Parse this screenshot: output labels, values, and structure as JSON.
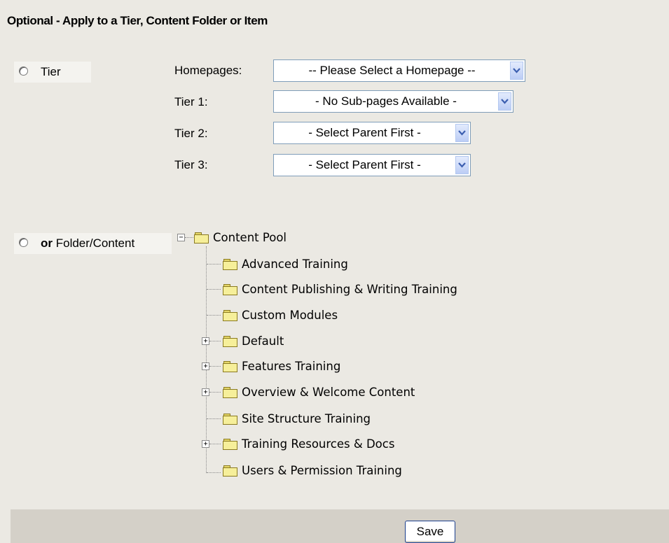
{
  "heading": "Optional - Apply to a Tier, Content Folder or Item",
  "tier_option": {
    "label": "Tier",
    "fields": [
      {
        "label": "Homepages:",
        "value": "-- Please Select a Homepage --"
      },
      {
        "label": "Tier 1:",
        "value": "- No Sub-pages Available -"
      },
      {
        "label": "Tier 2:",
        "value": "- Select Parent First -"
      },
      {
        "label": "Tier 3:",
        "value": "- Select Parent First -"
      }
    ]
  },
  "folder_option": {
    "label_bold": "or",
    "label": "Folder/Content",
    "root": {
      "label": "Content Pool",
      "expanded": true
    },
    "children": [
      {
        "label": "Advanced Training",
        "expandable": false
      },
      {
        "label": "Content Publishing & Writing Training",
        "expandable": false
      },
      {
        "label": "Custom Modules",
        "expandable": false
      },
      {
        "label": "Default",
        "expandable": true
      },
      {
        "label": "Features Training",
        "expandable": true
      },
      {
        "label": "Overview & Welcome Content",
        "expandable": true
      },
      {
        "label": "Site Structure Training",
        "expandable": false
      },
      {
        "label": "Training Resources & Docs",
        "expandable": true
      },
      {
        "label": "Users & Permission Training",
        "expandable": false
      }
    ]
  },
  "save_button": "Save",
  "icons": {
    "dropdown": "chevron-down-icon",
    "folder": "folder-icon",
    "expand": "plus-expander-icon",
    "collapse": "minus-collapser-icon"
  },
  "colors": {
    "background": "#ebe9e3",
    "select_border": "#7f9db9",
    "arrow_button": "#bccdf5",
    "folder": "#f6ef9a",
    "footer": "#d4d0c8"
  }
}
